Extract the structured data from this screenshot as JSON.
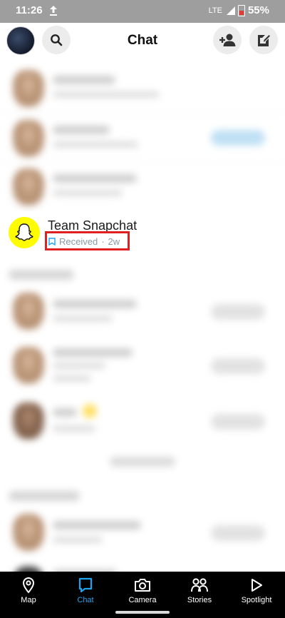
{
  "status_bar": {
    "time": "11:26",
    "network": "LTE",
    "battery": "55%"
  },
  "header": {
    "title": "Chat"
  },
  "team_chat": {
    "name": "Team Snapchat",
    "status": "Received",
    "separator": "·",
    "age": "2w"
  },
  "nav": {
    "items": [
      {
        "label": "Map",
        "icon": "map-pin-icon"
      },
      {
        "label": "Chat",
        "icon": "chat-bubble-icon"
      },
      {
        "label": "Camera",
        "icon": "camera-icon"
      },
      {
        "label": "Stories",
        "icon": "stories-icon"
      },
      {
        "label": "Spotlight",
        "icon": "play-icon"
      }
    ],
    "active_index": 1
  },
  "colors": {
    "status_bar": "#9e9e9e",
    "snapchat_yellow": "#fffc00",
    "active_tab": "#1ea5f0",
    "highlight_box": "#e0201e",
    "status_text": "#8a9aa7"
  }
}
